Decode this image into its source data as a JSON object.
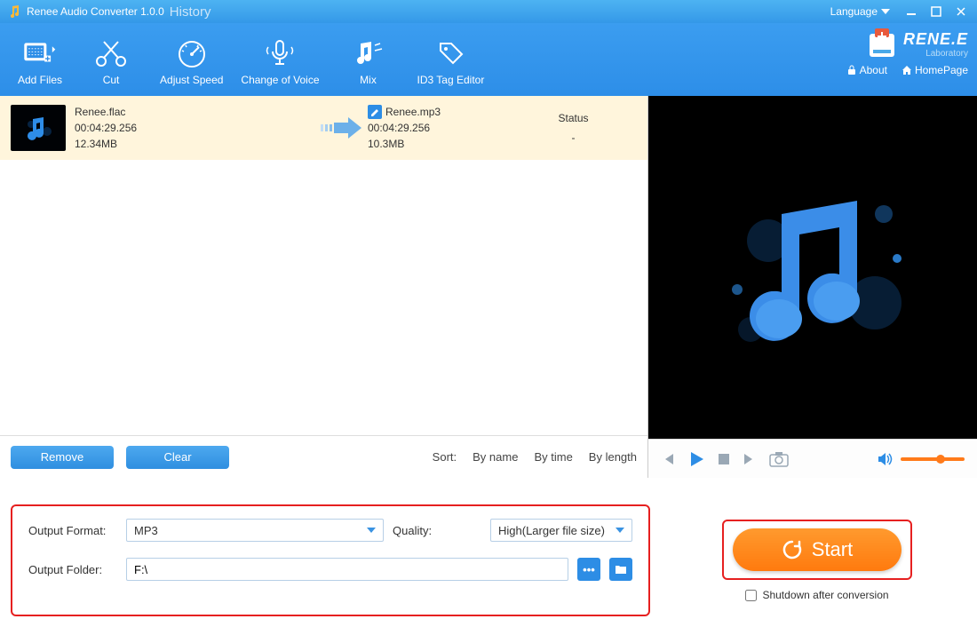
{
  "titlebar": {
    "title": "Renee Audio Converter 1.0.0",
    "history": "History",
    "language": "Language"
  },
  "brand": {
    "name": "RENE.E",
    "sub": "Laboratory",
    "about": "About",
    "homepage": "HomePage"
  },
  "toolbar": {
    "add_files": "Add Files",
    "cut": "Cut",
    "adjust_speed": "Adjust Speed",
    "change_voice": "Change of Voice",
    "mix": "Mix",
    "id3": "ID3 Tag Editor"
  },
  "file": {
    "src_name": "Renee.flac",
    "src_duration": "00:04:29.256",
    "src_size": "12.34MB",
    "dst_name": "Renee.mp3",
    "dst_duration": "00:04:29.256",
    "dst_size": "10.3MB",
    "status_header": "Status",
    "status_value": "-"
  },
  "list_footer": {
    "remove": "Remove",
    "clear": "Clear",
    "sort_label": "Sort:",
    "by_name": "By name",
    "by_time": "By time",
    "by_length": "By length"
  },
  "settings": {
    "output_format_label": "Output Format:",
    "output_format_value": "MP3",
    "quality_label": "Quality:",
    "quality_value": "High(Larger file size)",
    "output_folder_label": "Output Folder:",
    "output_folder_value": "F:\\"
  },
  "start": {
    "label": "Start",
    "shutdown": "Shutdown after conversion"
  }
}
